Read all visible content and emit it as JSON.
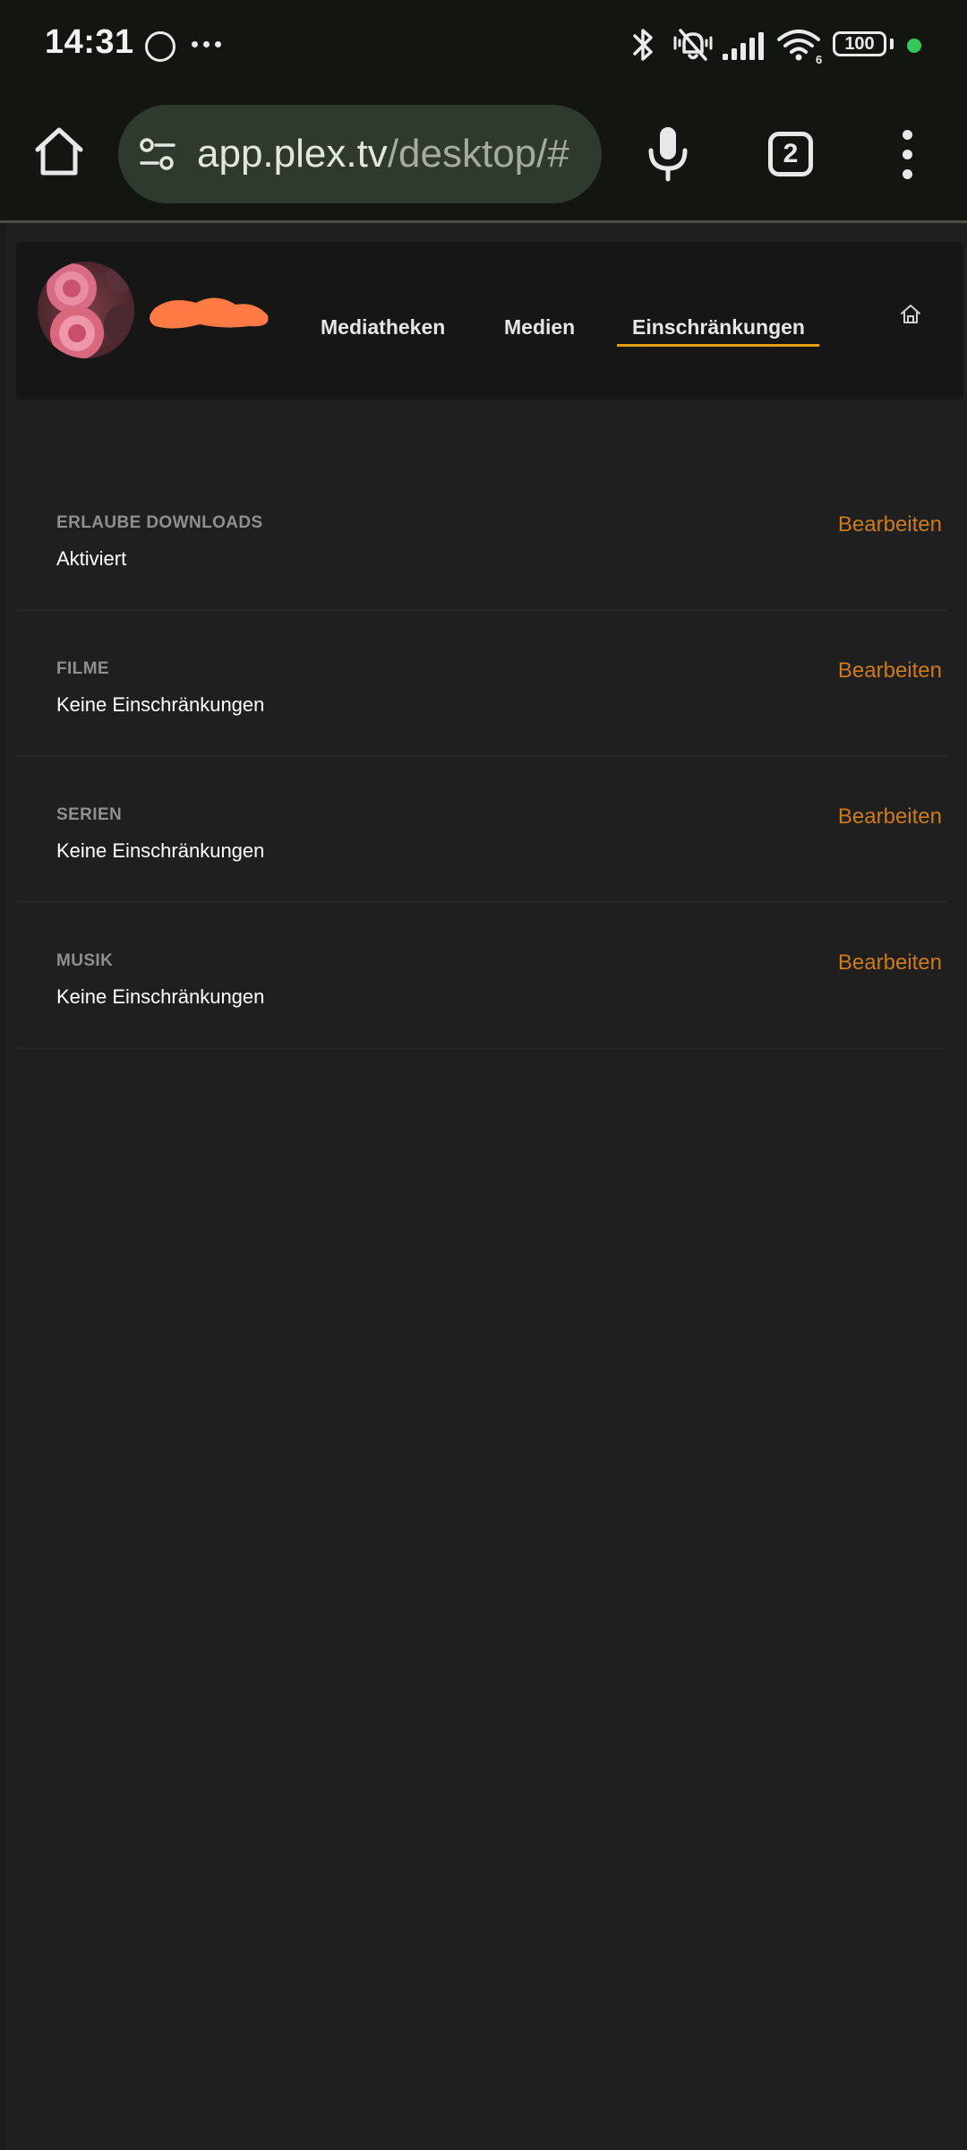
{
  "status_bar": {
    "time": "14:31",
    "battery_level": "100",
    "icons": [
      "circle-notification-icon",
      "more-notifications-icon",
      "bluetooth-icon",
      "muted-bell-icon",
      "cellular-signal-icon",
      "wifi-6-icon",
      "battery-icon",
      "privacy-indicator-icon"
    ],
    "privacy_dot_color": "#34c759"
  },
  "browser": {
    "url_host": "app.plex.tv",
    "url_path": "/desktop/#",
    "tab_count": "2",
    "icons": [
      "home-icon",
      "tune-icon",
      "microphone-icon",
      "more-vertical-icon"
    ]
  },
  "header": {
    "tabs": [
      {
        "label": "Mediatheken",
        "active": false
      },
      {
        "label": "Medien",
        "active": false
      },
      {
        "label": "Einschränkungen",
        "active": true
      }
    ],
    "active_color": "#e5a00d",
    "icons": [
      "avatar-image",
      "username-redaction",
      "home-outline-icon"
    ]
  },
  "restrictions": [
    {
      "title": "ERLAUBE DOWNLOADS",
      "value": "Aktiviert",
      "action": "Bearbeiten"
    },
    {
      "title": "FILME",
      "value": "Keine Einschränkungen",
      "action": "Bearbeiten"
    },
    {
      "title": "SERIEN",
      "value": "Keine Einschränkungen",
      "action": "Bearbeiten"
    },
    {
      "title": "MUSIK",
      "value": "Keine Einschränkungen",
      "action": "Bearbeiten"
    }
  ],
  "colors": {
    "action": "#cc7b19",
    "background": "#1f1f1f",
    "header_background": "#161616"
  }
}
